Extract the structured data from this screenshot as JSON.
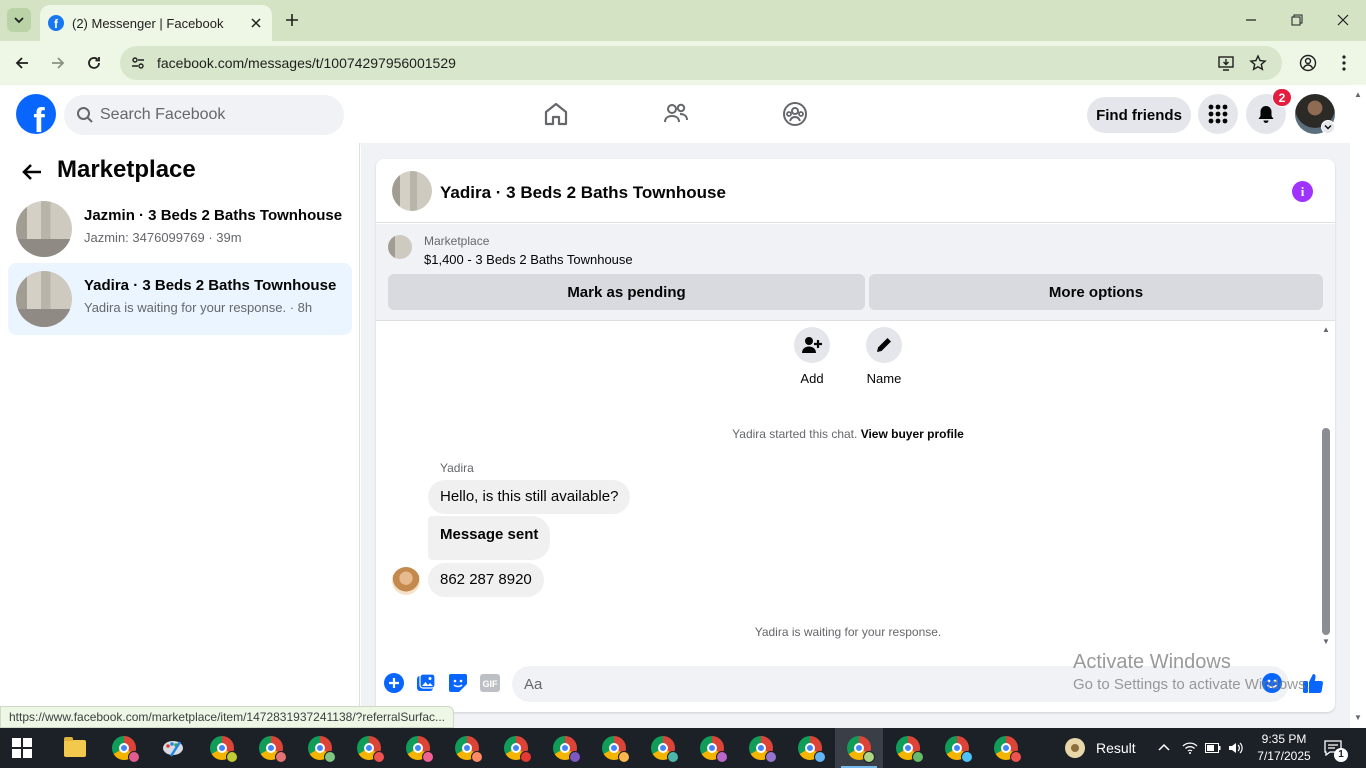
{
  "browser": {
    "tab_title": "(2) Messenger | Facebook",
    "url": "facebook.com/messages/t/10074297956001529",
    "status_url": "https://www.facebook.com/marketplace/item/1472831937241138/?referralSurfac..."
  },
  "fb_header": {
    "search_placeholder": "Search Facebook",
    "find_friends_label": "Find friends",
    "notification_count": "2"
  },
  "sidebar": {
    "title": "Marketplace",
    "conversations": [
      {
        "name": "Jazmin · 3 Beds 2 Baths Townhouse",
        "preview": "Jazmin: 3476099769 · 39m",
        "active": false
      },
      {
        "name": "Yadira · 3 Beds 2 Baths Townhouse",
        "preview": "Yadira is waiting for your response. · 8h",
        "active": true
      }
    ]
  },
  "chat": {
    "title": "Yadira · 3 Beds 2 Baths Townhouse",
    "marketplace_label": "Marketplace",
    "listing": "$1,400 - 3 Beds 2 Baths Townhouse",
    "mark_pending_label": "Mark as pending",
    "more_options_label": "More options",
    "add_label": "Add",
    "name_label": "Name",
    "started_text": "Yadira started this chat.",
    "view_profile_label": "View buyer profile",
    "sender_name": "Yadira",
    "messages": [
      "Hello, is this still available?",
      "Message sent",
      "862 287 8920"
    ],
    "waiting_text": "Yadira is waiting for your response.",
    "composer_placeholder": "Aa"
  },
  "watermark": {
    "line1": "Activate Windows",
    "line2": "Go to Settings to activate Windows."
  },
  "taskbar": {
    "weather_label": "Result",
    "time": "9:35 PM",
    "date": "7/17/2025",
    "notification_count": "1"
  },
  "colors": {
    "fb_blue": "#0866ff",
    "active_conv_bg": "#ebf5ff",
    "info_purple": "#a033ff",
    "badge_red": "#e41e3f",
    "chrome_frame": "#d3e3c4"
  }
}
